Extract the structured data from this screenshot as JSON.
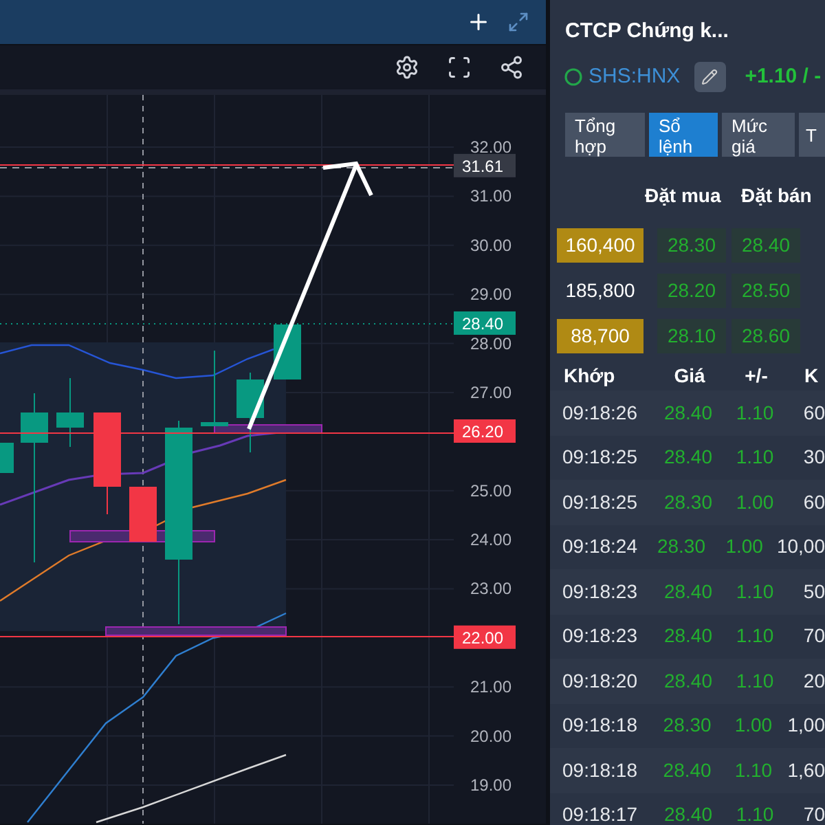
{
  "chart": {
    "axis_labels": [
      "32.00",
      "31.00",
      "30.00",
      "29.00",
      "28.00",
      "27.00",
      "25.00",
      "24.00",
      "23.00",
      "21.00",
      "20.00",
      "19.00"
    ],
    "price_tags": [
      {
        "text": "31.61",
        "kind": "target"
      },
      {
        "text": "28.40",
        "kind": "last"
      },
      {
        "text": "26.20",
        "kind": "level"
      },
      {
        "text": "22.00",
        "kind": "level"
      }
    ]
  },
  "stock": {
    "title": "CTCP Chứng k...",
    "symbol": "SHS:HNX",
    "change": "+1.10 / -"
  },
  "tabs": [
    {
      "label": "Tổng hợp",
      "selected": false
    },
    {
      "label": "Sổ lệnh",
      "selected": true
    },
    {
      "label": "Mức giá",
      "selected": false
    },
    {
      "label": "T",
      "selected": false
    }
  ],
  "order_book": {
    "columns": [
      "Đặt mua",
      "Đặt bán"
    ],
    "rows": [
      {
        "volume": "160,400",
        "highlight": true,
        "bid": "28.30",
        "ask": "28.40"
      },
      {
        "volume": "185,800",
        "highlight": false,
        "bid": "28.20",
        "ask": "28.50"
      },
      {
        "volume": "88,700",
        "highlight": true,
        "bid": "28.10",
        "ask": "28.60"
      }
    ]
  },
  "trades": {
    "columns": [
      "Khớp",
      "Giá",
      "+/-",
      "K"
    ],
    "rows": [
      {
        "time": "09:18:26",
        "price": "28.40",
        "change": "1.10",
        "volume": "60"
      },
      {
        "time": "09:18:25",
        "price": "28.40",
        "change": "1.10",
        "volume": "30"
      },
      {
        "time": "09:18:25",
        "price": "28.30",
        "change": "1.00",
        "volume": "60"
      },
      {
        "time": "09:18:24",
        "price": "28.30",
        "change": "1.00",
        "volume": "10,00"
      },
      {
        "time": "09:18:23",
        "price": "28.40",
        "change": "1.10",
        "volume": "50"
      },
      {
        "time": "09:18:23",
        "price": "28.40",
        "change": "1.10",
        "volume": "70"
      },
      {
        "time": "09:18:20",
        "price": "28.40",
        "change": "1.10",
        "volume": "20"
      },
      {
        "time": "09:18:18",
        "price": "28.30",
        "change": "1.00",
        "volume": "1,00"
      },
      {
        "time": "09:18:18",
        "price": "28.40",
        "change": "1.10",
        "volume": "1,60"
      },
      {
        "time": "09:18:17",
        "price": "28.40",
        "change": "1.10",
        "volume": "70"
      }
    ]
  }
}
